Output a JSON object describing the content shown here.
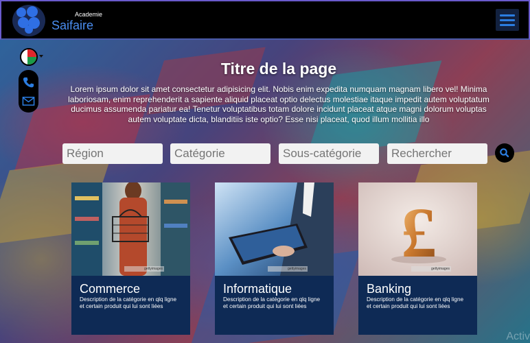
{
  "header": {
    "brand_sub": "Academie",
    "brand": "Saifaire",
    "menu_icon": "hamburger-menu-icon"
  },
  "sidebar": {
    "flag_icon": "madagascar-flag-icon",
    "phone_icon": "phone-icon",
    "mail_icon": "mail-icon"
  },
  "hero": {
    "title": "Titre de la page",
    "intro": "Lorem ipsum dolor sit amet consectetur adipisicing elit. Nobis enim expedita numquam magnam libero vel! Minima laboriosam, enim reprehenderit a sapiente aliquid placeat optio delectus molestiae itaque impedit autem voluptatum ducimus assumenda pariatur ea! Tenetur voluptatibus totam dolore incidunt placeat atque magni dolorum voluptas autem voluptate dicta, blanditiis iste optio? Esse nisi placeat, quod illum mollitia illo"
  },
  "filters": {
    "region_placeholder": "Région",
    "category_placeholder": "Catégorie",
    "subcategory_placeholder": "Sous-catégorie",
    "search_placeholder": "Rechercher",
    "search_icon": "search-icon"
  },
  "cards": [
    {
      "title": "Commerce",
      "desc": "Description de la catégorie en qlq ligne et certain produit qui lui sont liées"
    },
    {
      "title": "Informatique",
      "desc": "Description de la catégorie en qlq ligne et certain produit qui lui sont liées"
    },
    {
      "title": "Banking",
      "desc": "Description de la catégorie en qlq ligne et certain produit qui lui sont liées"
    }
  ],
  "watermark": "gettyimages",
  "system": {
    "activate": "Activ"
  },
  "colors": {
    "accent": "#2b7de0",
    "card_bg": "#0e2a55",
    "header_bg": "#000000"
  }
}
